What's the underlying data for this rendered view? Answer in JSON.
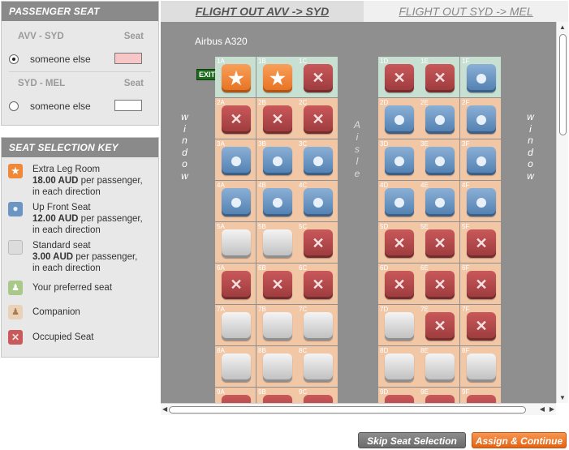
{
  "passenger_panel": {
    "title": "PASSENGER SEAT",
    "routes": [
      {
        "route": "AVV - SYD",
        "seat_header": "Seat",
        "passenger": "someone else",
        "selected": true,
        "seat_color": "#f7c6c6"
      },
      {
        "route": "SYD - MEL",
        "seat_header": "Seat",
        "passenger": "someone else",
        "selected": false,
        "seat_color": "#ffffff"
      }
    ]
  },
  "key_panel": {
    "title": "SEAT SELECTION KEY",
    "items": [
      {
        "icon": "star-seat-icon",
        "color": "#f0883a",
        "line1": "Extra Leg Room",
        "price": "18.00 AUD",
        "line2": "per passenger,",
        "line3": "in each direction"
      },
      {
        "icon": "up-front-seat-icon",
        "color": "#6c95c4",
        "line1": "Up Front Seat",
        "price": "12.00 AUD",
        "line2": "per passenger,",
        "line3": "in each direction"
      },
      {
        "icon": "standard-seat-icon",
        "color": "#dcdcdc",
        "line1": "Standard seat",
        "price": "3.00 AUD",
        "line2": "per passenger,",
        "line3": "in each direction"
      },
      {
        "icon": "preferred-seat-icon",
        "color": "#a9c98a",
        "line1": "Your preferred seat"
      },
      {
        "icon": "companion-seat-icon",
        "color": "#e9d2b8",
        "line1": "Companion"
      },
      {
        "icon": "occupied-seat-icon",
        "color": "#c95a5c",
        "line1": "Occupied Seat"
      }
    ]
  },
  "tabs": [
    {
      "label": "FLIGHT OUT AVV -> SYD",
      "active": true
    },
    {
      "label": "FLIGHT OUT SYD -> MEL",
      "active": false
    }
  ],
  "seatmap": {
    "aircraft": "Airbus A320",
    "window_label": "window",
    "aisle_label": "Aisle",
    "exit_label": "EXIT",
    "rows": [
      {
        "row": "1",
        "seats": {
          "A": "extra",
          "B": "extra",
          "C": "occupied",
          "D": "occupied",
          "E": "occupied",
          "F": "upfront"
        }
      },
      {
        "row": "2",
        "seats": {
          "A": "occupied",
          "B": "occupied",
          "C": "occupied",
          "D": "upfront",
          "E": "upfront",
          "F": "upfront"
        }
      },
      {
        "row": "3",
        "seats": {
          "A": "upfront",
          "B": "upfront",
          "C": "upfront",
          "D": "upfront",
          "E": "upfront",
          "F": "upfront"
        }
      },
      {
        "row": "4",
        "seats": {
          "A": "upfront",
          "B": "upfront",
          "C": "upfront",
          "D": "upfront",
          "E": "upfront",
          "F": "upfront"
        }
      },
      {
        "row": "5",
        "seats": {
          "A": "standard",
          "B": "standard",
          "C": "occupied",
          "D": "occupied",
          "E": "occupied",
          "F": "occupied"
        }
      },
      {
        "row": "6",
        "seats": {
          "A": "occupied",
          "B": "occupied",
          "C": "occupied",
          "D": "occupied",
          "E": "occupied",
          "F": "occupied"
        }
      },
      {
        "row": "7",
        "seats": {
          "A": "standard",
          "B": "standard",
          "C": "standard",
          "D": "standard",
          "E": "occupied",
          "F": "occupied"
        }
      },
      {
        "row": "8",
        "seats": {
          "A": "standard",
          "B": "standard",
          "C": "standard",
          "D": "standard",
          "E": "standard",
          "F": "standard"
        }
      },
      {
        "row": "9",
        "seats": {
          "A": "occupied",
          "B": "occupied",
          "C": "occupied",
          "D": "occupied",
          "E": "occupied",
          "F": "occupied"
        }
      }
    ]
  },
  "buttons": {
    "skip": "Skip Seat Selection",
    "assign": "Assign & Continue"
  }
}
